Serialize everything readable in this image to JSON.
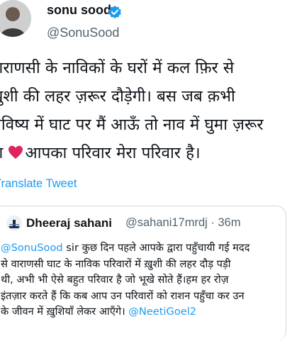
{
  "tweet": {
    "author": {
      "display_name": "sonu sood",
      "handle": "@SonuSood",
      "verified": true
    },
    "text_lines": [
      "वाराणसी के नाविकों के घरों में कल फ़िर से",
      "ख़ुशी की लहर ज़रूर दौड़ेगी। बस जब क़भी",
      "भविष्य में घाट पर मैं आऊँ तो नाव में घुमा ज़रूर",
      "आपका  परिवार मेरा परिवार है।"
    ],
    "line4_prefix": "ना",
    "translate_label": "Translate Tweet"
  },
  "quote": {
    "author": {
      "display_name": "Dheeraj sahani",
      "handle": "@sahani17mrdj",
      "separator": "·",
      "time": "36m"
    },
    "mention_start": "@SonuSood",
    "text_line1_rest": " sir कुछ दिन पहले आपके द्वारा पहुँचायी गई मदद",
    "text_lines": [
      "से वाराणसी घाट के नाविक परिवारों में ख़ुशी  की लहर दौड़ पड़ी",
      "थी, अभी भी ऐसे बहुत परिवार है जो भूखे सोते हैं।हम हर रोज़",
      "इंतज़ार करते हैं कि कब आप उन परिवारों को राशन पहुँचा कर उन"
    ],
    "text_line5_prefix": "के जीवन में ख़ुशियाँ लेकर आएँगे। ",
    "mention_end": "@NeetiGoel2"
  },
  "colors": {
    "link": "#1d9bf0",
    "verified": "#1d9bf0",
    "heart": "#e0245e",
    "secondary_text": "#536471",
    "border": "#cfd9de"
  }
}
